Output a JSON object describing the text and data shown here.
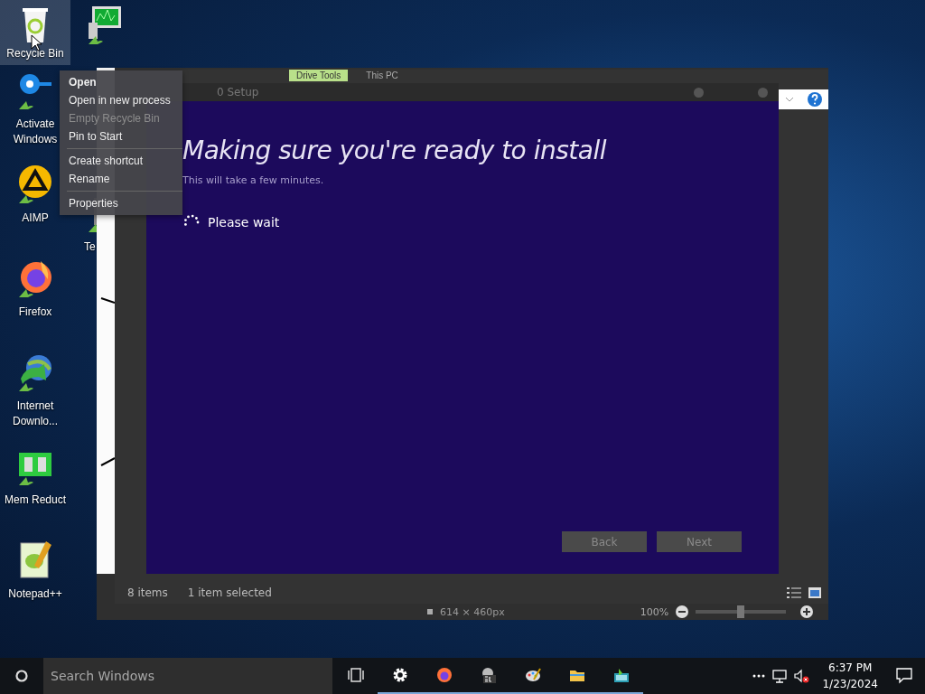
{
  "desktop_icons": [
    {
      "kind": "recycle",
      "label": "Recycle Bin",
      "selected": true
    },
    {
      "kind": "key",
      "label": "Activate Windows",
      "selected": false
    },
    {
      "kind": "aimp",
      "label": "AIMP",
      "selected": false
    },
    {
      "kind": "firefox",
      "label": "Firefox",
      "selected": false
    },
    {
      "kind": "globe",
      "label": "Internet Downlo...",
      "selected": false
    },
    {
      "kind": "memory",
      "label": "Mem Reduct",
      "selected": false
    },
    {
      "kind": "notepad",
      "label": "Notepad++",
      "selected": false
    }
  ],
  "desktop_icons_column_2": [
    {
      "kind": "monitor"
    },
    {
      "kind": "app",
      "label": "Te"
    }
  ],
  "image_viewer": {
    "dimensions": "614 × 460px",
    "zoom": "100%",
    "zoom_slider": {
      "level": 0.5
    }
  },
  "explorer": {
    "tabs": [
      {
        "label": "Drive Tools",
        "selected": true
      },
      {
        "label": "This PC",
        "selected": false
      }
    ],
    "status_bar": {
      "item_count": "8 items",
      "selection": "1 item selected"
    }
  },
  "setup": {
    "title": "0 Setup",
    "heading": "Making sure you're ready to install",
    "subtitle": "This will take a few minutes.",
    "status": "Please wait",
    "buttons": [
      {
        "label": "Back",
        "disabled": true
      },
      {
        "label": "Next",
        "disabled": true
      }
    ]
  },
  "context_menu": [
    {
      "kind": "item",
      "label": "Open",
      "default": true,
      "disabled": false
    },
    {
      "kind": "item",
      "label": "Open in new process",
      "default": false,
      "disabled": false
    },
    {
      "kind": "item",
      "label": "Empty Recycle Bin",
      "default": false,
      "disabled": true
    },
    {
      "kind": "item",
      "label": "Pin to Start",
      "default": false,
      "disabled": false
    },
    {
      "kind": "separator"
    },
    {
      "kind": "item",
      "label": "Create shortcut",
      "default": false,
      "disabled": false
    },
    {
      "kind": "item",
      "label": "Rename",
      "default": false,
      "disabled": false
    },
    {
      "kind": "separator"
    },
    {
      "kind": "item",
      "label": "Properties",
      "default": false,
      "disabled": false
    }
  ],
  "taskbar": {
    "search": {
      "placeholder": "Search Windows"
    },
    "apps": [
      {
        "kind": "taskview",
        "running": false
      },
      {
        "kind": "gear",
        "running": true
      },
      {
        "kind": "firefox",
        "running": true
      },
      {
        "kind": "sd",
        "running": true
      },
      {
        "kind": "paint",
        "running": true
      },
      {
        "kind": "folder",
        "running": true
      },
      {
        "kind": "green",
        "running": true
      }
    ],
    "clock": {
      "time": "6:37 PM",
      "date": "1/23/2024"
    }
  }
}
